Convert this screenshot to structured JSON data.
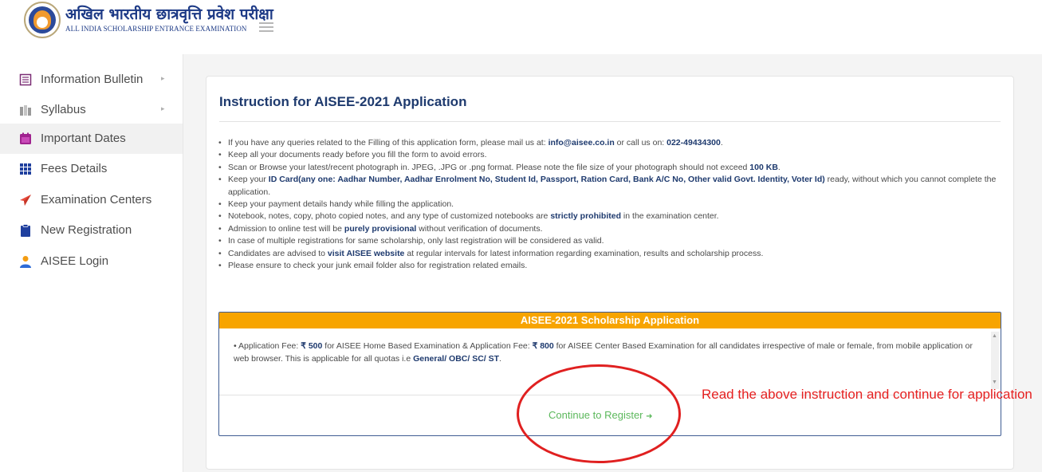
{
  "header": {
    "title_hindi": "अखिल भारतीय छात्रवृत्ति प्रवेश परीक्षा",
    "title_english": "ALL INDIA SCHOLARSHIP ENTRANCE EXAMINATION",
    "menu_icon": "hamburger-icon"
  },
  "sidebar": {
    "items": [
      {
        "label": "Information Bulletin",
        "icon": "bulletin-icon",
        "has_submenu": true
      },
      {
        "label": "Syllabus",
        "icon": "books-icon",
        "has_submenu": true
      },
      {
        "label": "Important Dates",
        "icon": "calendar-icon",
        "active": true
      },
      {
        "label": "Fees Details",
        "icon": "grid-icon"
      },
      {
        "label": "Examination Centers",
        "icon": "paper-plane-icon"
      },
      {
        "label": "New Registration",
        "icon": "clipboard-icon"
      },
      {
        "label": "AISEE Login",
        "icon": "user-icon"
      }
    ],
    "caret": "▸"
  },
  "main": {
    "title": "Instruction for AISEE-2021 Application",
    "instructions": [
      {
        "pre": "If you have any queries related to the Filling of this application form, please mail us at: ",
        "b1": "info@aisee.co.in",
        "mid": " or call us on: ",
        "b2": "022-49434300",
        "post": "."
      },
      {
        "pre": "Keep all your documents ready before you fill the form to avoid errors."
      },
      {
        "pre": "Scan or Browse your latest/recent photograph in. JPEG, .JPG or .png format. Please note the file size of your photograph should not exceed ",
        "b1": "100 KB",
        "post": "."
      },
      {
        "pre": "Keep your ",
        "b1": "ID Card(any one: Aadhar Number, Aadhar Enrolment No, Student Id, Passport, Ration Card, Bank A/C No, Other valid Govt. Identity, Voter Id)",
        "post": " ready, without which you cannot complete the application."
      },
      {
        "pre": "Keep your payment details handy while filling the application."
      },
      {
        "pre": "Notebook, notes, copy, photo copied notes, and any type of customized notebooks are ",
        "b1": "strictly prohibited",
        "post": " in the examination center."
      },
      {
        "pre": "Admission to online test will be ",
        "b1": "purely provisional",
        "post": " without verification of documents."
      },
      {
        "pre": "In case of multiple registrations for same scholarship, only last registration will be considered as valid."
      },
      {
        "pre": "Candidates are advised to ",
        "b1": "visit AISEE website",
        "post": " at regular intervals for latest information regarding examination, results and scholarship process."
      },
      {
        "pre": "Please ensure to check your junk email folder also for registration related emails."
      }
    ],
    "application": {
      "heading": "AISEE-2021 Scholarship Application",
      "fee": {
        "p1": "Application Fee: ",
        "amt1": "₹ 500",
        "p2": " for AISEE Home Based Examination & Application Fee: ",
        "amt2": "₹ 800",
        "p3": " for AISEE Center Based Examination for all candidates irrespective of male or female, from mobile application or web browser. This is applicable for all quotas i.e ",
        "quotas": "General/ OBC/ SC/ ST",
        "p4": "."
      },
      "continue_label": "Continue to Register",
      "continue_arrow": "➜"
    },
    "annotation": "Read the above instruction and continue for application"
  },
  "colors": {
    "accent_orange": "#f7a400",
    "title_blue": "#1e3a6e",
    "continue_green": "#5cb85c",
    "annotation_red": "#e52020"
  }
}
